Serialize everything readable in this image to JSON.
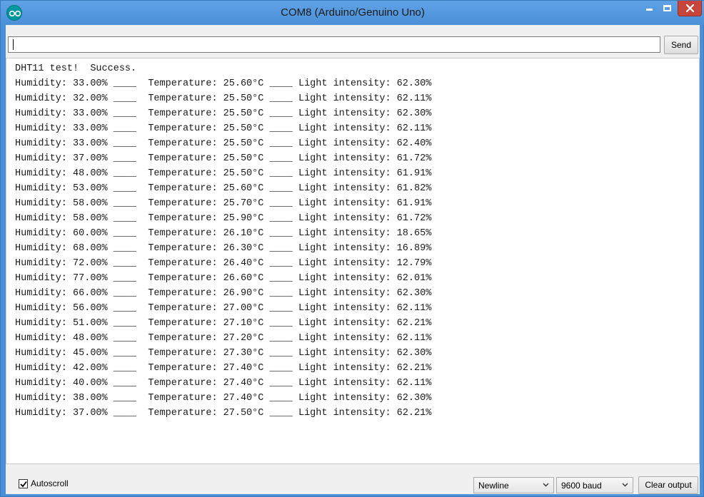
{
  "window": {
    "title": "COM8 (Arduino/Genuino Uno)"
  },
  "send_bar": {
    "input_value": "",
    "send_label": "Send"
  },
  "output_lines": [
    "DHT11 test!  Success.",
    "Humidity: 33.00% ____  Temperature: 25.60°C ____ Light intensity: 62.30%",
    "Humidity: 32.00% ____  Temperature: 25.50°C ____ Light intensity: 62.11%",
    "Humidity: 33.00% ____  Temperature: 25.50°C ____ Light intensity: 62.30%",
    "Humidity: 33.00% ____  Temperature: 25.50°C ____ Light intensity: 62.11%",
    "Humidity: 33.00% ____  Temperature: 25.50°C ____ Light intensity: 62.40%",
    "Humidity: 37.00% ____  Temperature: 25.50°C ____ Light intensity: 61.72%",
    "Humidity: 48.00% ____  Temperature: 25.50°C ____ Light intensity: 61.91%",
    "Humidity: 53.00% ____  Temperature: 25.60°C ____ Light intensity: 61.82%",
    "Humidity: 58.00% ____  Temperature: 25.70°C ____ Light intensity: 61.91%",
    "Humidity: 58.00% ____  Temperature: 25.90°C ____ Light intensity: 61.72%",
    "Humidity: 60.00% ____  Temperature: 26.10°C ____ Light intensity: 18.65%",
    "Humidity: 68.00% ____  Temperature: 26.30°C ____ Light intensity: 16.89%",
    "Humidity: 72.00% ____  Temperature: 26.40°C ____ Light intensity: 12.79%",
    "Humidity: 77.00% ____  Temperature: 26.60°C ____ Light intensity: 62.01%",
    "Humidity: 66.00% ____  Temperature: 26.90°C ____ Light intensity: 62.30%",
    "Humidity: 56.00% ____  Temperature: 27.00°C ____ Light intensity: 62.11%",
    "Humidity: 51.00% ____  Temperature: 27.10°C ____ Light intensity: 62.21%",
    "Humidity: 48.00% ____  Temperature: 27.20°C ____ Light intensity: 62.11%",
    "Humidity: 45.00% ____  Temperature: 27.30°C ____ Light intensity: 62.30%",
    "Humidity: 42.00% ____  Temperature: 27.40°C ____ Light intensity: 62.21%",
    "Humidity: 40.00% ____  Temperature: 27.40°C ____ Light intensity: 62.11%",
    "Humidity: 38.00% ____  Temperature: 27.40°C ____ Light intensity: 62.30%",
    "Humidity: 37.00% ____  Temperature: 27.50°C ____ Light intensity: 62.21%"
  ],
  "bottom_bar": {
    "autoscroll_label": "Autoscroll",
    "autoscroll_checked": true,
    "line_ending": "Newline",
    "baud_rate": "9600 baud",
    "clear_label": "Clear output"
  },
  "icons": {
    "app": "arduino-logo-icon",
    "minimize": "minimize-icon",
    "maximize": "maximize-icon",
    "close": "close-icon",
    "dropdown": "chevron-down-icon",
    "check": "checkmark-icon"
  },
  "colors": {
    "titlebar": "#4b8fd8",
    "close_button": "#c7453b",
    "arduino_teal": "#00979d"
  }
}
